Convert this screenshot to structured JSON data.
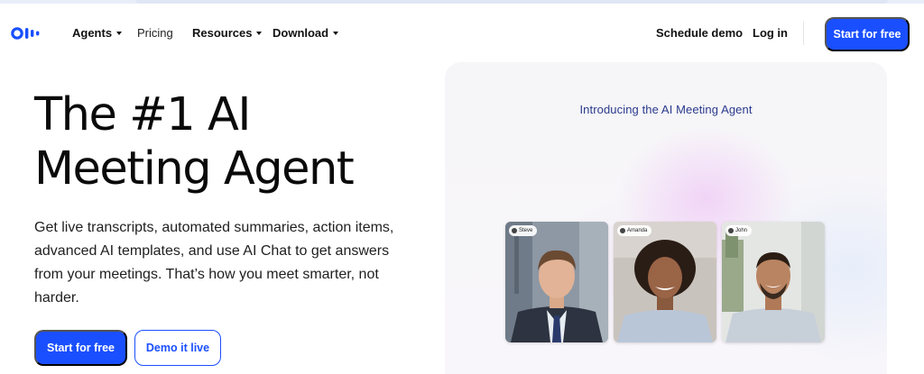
{
  "nav": {
    "logo_icon": "otter-logo-icon",
    "items": [
      {
        "label": "Agents",
        "has_dropdown": true
      },
      {
        "label": "Pricing",
        "has_dropdown": false
      },
      {
        "label": "Resources",
        "has_dropdown": true
      },
      {
        "label": "Download",
        "has_dropdown": true
      }
    ],
    "schedule_demo": "Schedule demo",
    "login": "Log in",
    "cta": "Start for free"
  },
  "hero": {
    "title_line1": "The #1 AI",
    "title_line2": "Meeting Agent",
    "subtitle": "Get live transcripts, automated summaries, action items, advanced AI templates, and use AI Chat to get answers from your meetings. That’s how you meet smarter, not harder.",
    "primary_cta": "Start for free",
    "secondary_cta": "Demo it live"
  },
  "video_panel": {
    "heading": "Introducing the AI Meeting Agent",
    "participants": [
      {
        "name": "Steve"
      },
      {
        "name": "Amanda"
      },
      {
        "name": "John"
      }
    ]
  },
  "colors": {
    "brand_blue": "#1a4fff",
    "panel_heading": "#2a3a8c"
  }
}
